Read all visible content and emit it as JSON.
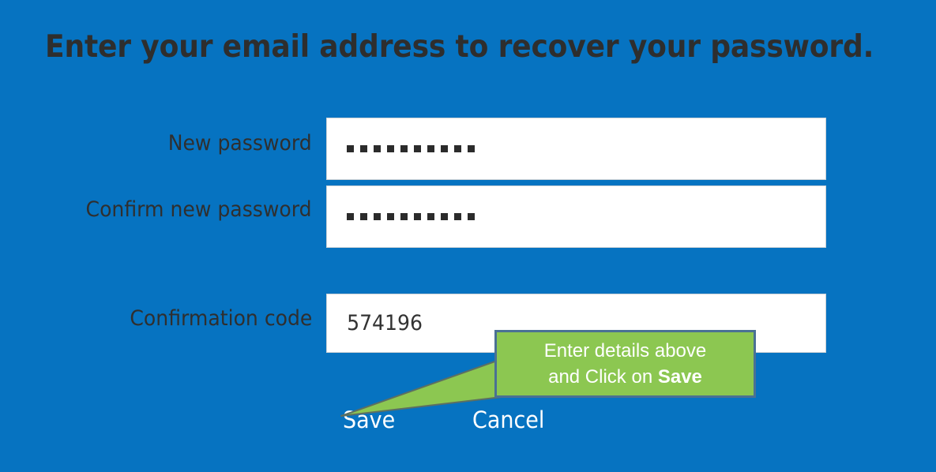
{
  "page": {
    "background_color": "#0673c1",
    "heading": "Enter your email address to recover your password."
  },
  "form": {
    "fields": [
      {
        "label": "New password",
        "type": "password",
        "masked_char_count": 10,
        "value": ""
      },
      {
        "label": "Confirm new password",
        "type": "password",
        "masked_char_count": 10,
        "value": ""
      },
      {
        "label": "Confirmation code",
        "type": "text",
        "value": "574196"
      }
    ]
  },
  "actions": {
    "save_label": "Save",
    "cancel_label": "Cancel",
    "link_color": "#ffffff"
  },
  "callout": {
    "line1": "Enter details above",
    "line2_prefix": "and Click on ",
    "line2_emphasis": "Save",
    "fill_color": "#8cc751",
    "border_color": "#4a7194",
    "text_color": "#ffffff",
    "points_at": "Save"
  }
}
